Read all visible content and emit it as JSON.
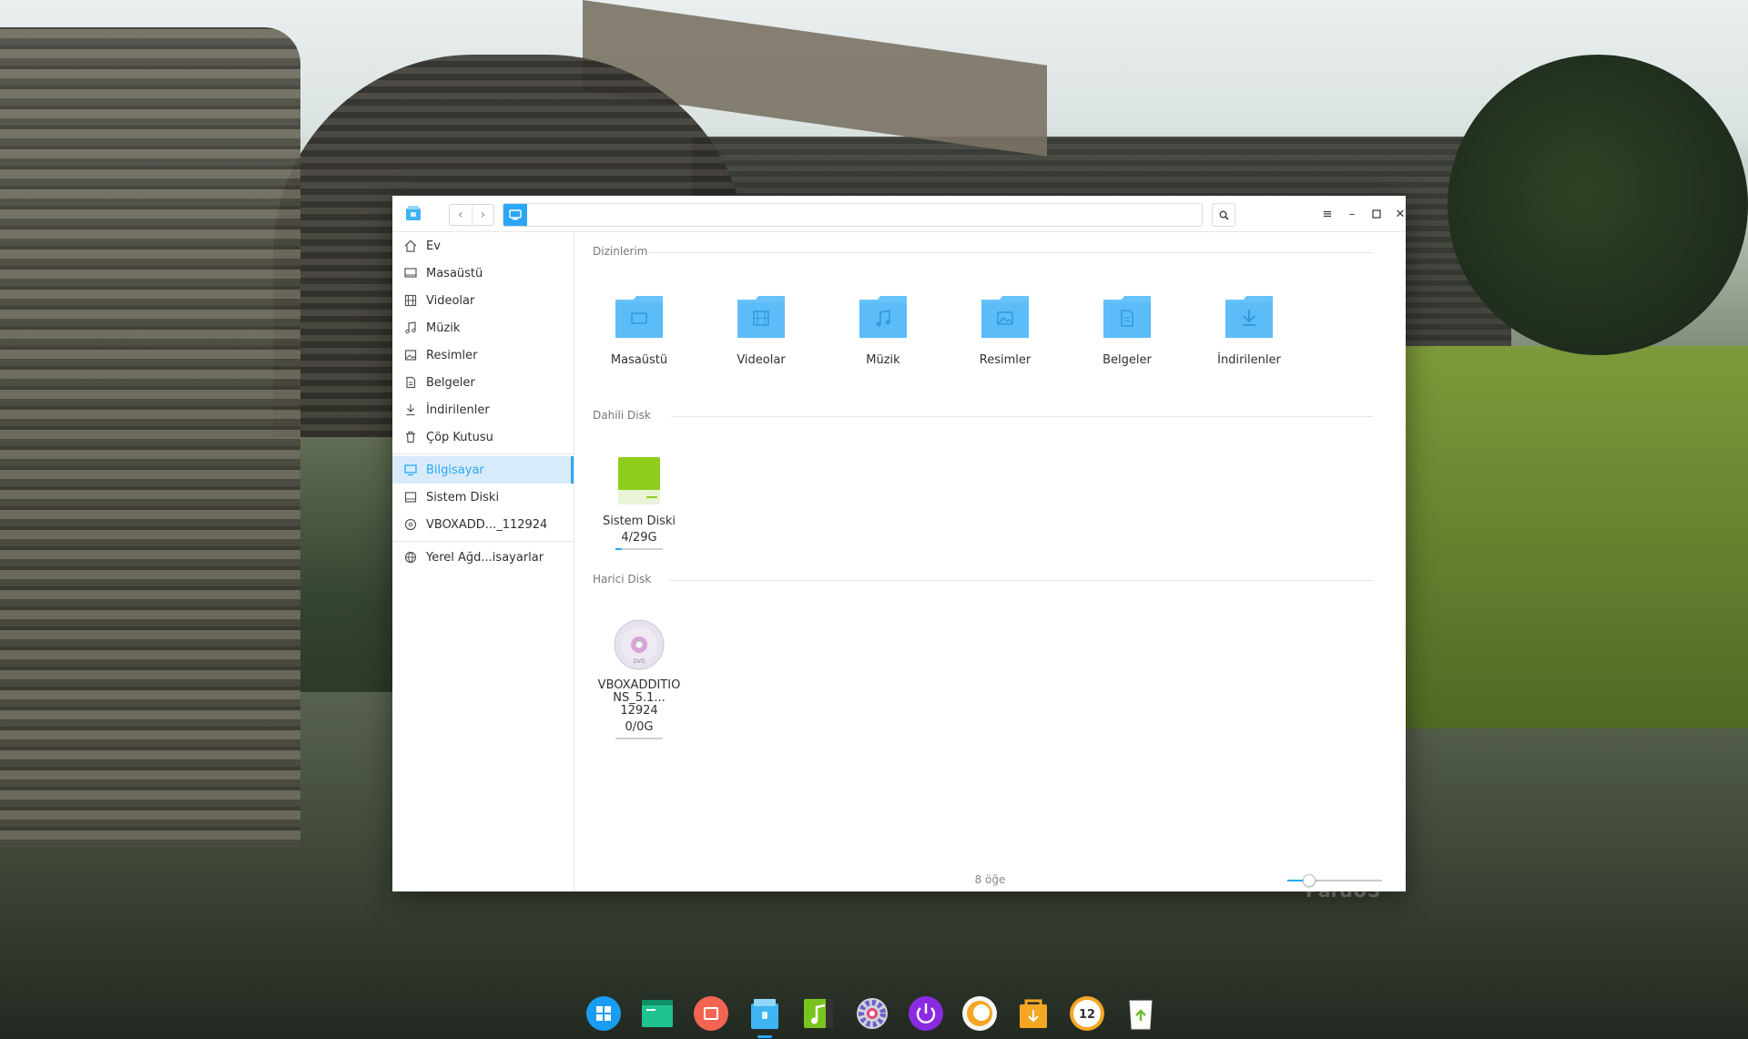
{
  "window": {
    "address_path": ""
  },
  "sidebar": {
    "items": [
      {
        "label": "Ev",
        "icon": "home-icon"
      },
      {
        "label": "Masaüstü",
        "icon": "desktop-icon"
      },
      {
        "label": "Videolar",
        "icon": "video-icon"
      },
      {
        "label": "Müzik",
        "icon": "music-icon"
      },
      {
        "label": "Resimler",
        "icon": "picture-icon"
      },
      {
        "label": "Belgeler",
        "icon": "document-icon"
      },
      {
        "label": "İndirilenler",
        "icon": "download-icon"
      },
      {
        "label": "Çöp Kutusu",
        "icon": "trash-icon"
      },
      {
        "label": "Bilgisayar",
        "icon": "computer-icon",
        "active": true
      },
      {
        "label": "Sistem Diski",
        "icon": "disk-icon"
      },
      {
        "label": "VBOXADD..._112924",
        "icon": "optical-disc-icon"
      },
      {
        "label": "Yerel Ağd...isayarlar",
        "icon": "network-icon"
      }
    ]
  },
  "main": {
    "sections": {
      "folders_title": "Dizinlerim",
      "internal_title": "Dahili Disk",
      "external_title": "Harici Disk"
    },
    "folders": [
      {
        "label": "Masaüstü",
        "icon": "desktop-folder-icon"
      },
      {
        "label": "Videolar",
        "icon": "video-folder-icon"
      },
      {
        "label": "Müzik",
        "icon": "music-folder-icon"
      },
      {
        "label": "Resimler",
        "icon": "picture-folder-icon"
      },
      {
        "label": "Belgeler",
        "icon": "document-folder-icon"
      },
      {
        "label": "İndirilenler",
        "icon": "download-folder-icon"
      }
    ],
    "internal_disk": {
      "label": "Sistem Diski",
      "usage": "4/29G",
      "used_fraction": 0.14
    },
    "external_disk": {
      "label_line1": "VBOXADDITIO",
      "label_line2": "NS_5.1...",
      "label_line3": "12924",
      "usage": "0/0G",
      "used_fraction": 0
    }
  },
  "status": {
    "item_count": "8 öğe",
    "zoom_level": 0.22
  },
  "wallpaper_brand": "PardUS",
  "colors": {
    "accent": "#2ca7f8",
    "folder": "#68c3fa",
    "disk_green": "#8fce1c"
  },
  "dock": {
    "items": [
      "launcher-icon",
      "terminal-icon",
      "screen-recorder-icon",
      "file-manager-icon",
      "music-player-icon",
      "settings-icon",
      "power-icon",
      "browser-icon",
      "store-icon",
      "clock-icon",
      "trash-icon"
    ]
  }
}
